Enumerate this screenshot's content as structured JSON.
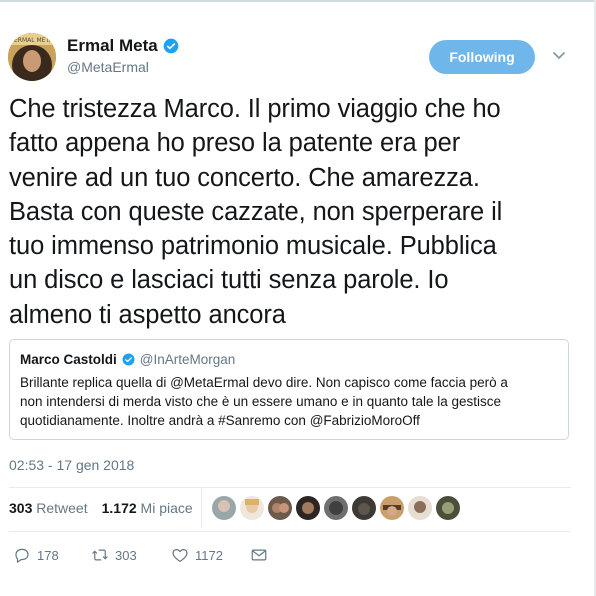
{
  "author": {
    "name": "Ermal Meta",
    "handle": "@MetaErmal",
    "follow_label": "Following"
  },
  "tweet": {
    "lines": [
      "Che tristezza Marco. Il primo viaggio che ho",
      "fatto appena ho preso la patente era per",
      "venire ad un tuo concerto. Che amarezza.",
      "Basta con queste cazzate, non sperperare il",
      "tuo immenso patrimonio musicale. Pubblica",
      "un disco e lasciaci tutti senza parole. Io",
      "almeno ti aspetto ancora"
    ]
  },
  "quote": {
    "name": "Marco Castoldi",
    "handle": "@InArteMorgan",
    "lines": [
      "Brillante replica quella di @MetaErmal devo dire. Non capisco come faccia però a",
      "non intendersi di merda visto che è un essere umano e in quanto tale la gestisce",
      "quotidianamente. Inoltre andrà a #Sanremo con @FabrizioMoroOff"
    ]
  },
  "timestamp": "02:53 - 17 gen 2018",
  "stats": {
    "retweets_count": "303",
    "retweets_label": "Retweet",
    "likes_count": "1.172",
    "likes_label": "Mi piace"
  },
  "actions": {
    "reply_count": "178",
    "retweet_count": "303",
    "like_count": "1172"
  },
  "icons": {
    "verified": "verified-badge-icon",
    "caret": "chevron-down-icon",
    "reply": "reply-icon",
    "retweet": "retweet-icon",
    "like": "heart-icon",
    "dm": "envelope-icon"
  },
  "colors": {
    "accent": "#1da1f2",
    "follow_button": "#6fb6ea",
    "muted_text": "#657786",
    "text": "#14171a"
  }
}
